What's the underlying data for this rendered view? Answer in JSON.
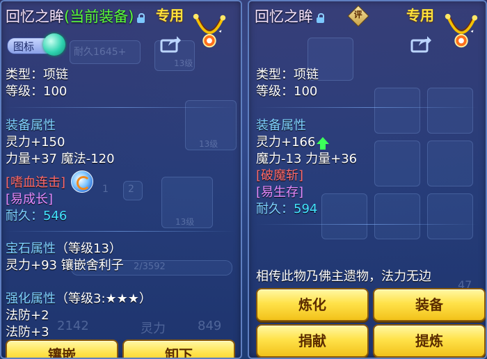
{
  "left": {
    "title": "回忆之眸",
    "equipped_tag": "(当前装备)",
    "exclusive": "专用",
    "icon_toggle_label": "图标",
    "type": "类型：项链",
    "level": "等级：100",
    "equip_attr_header": "装备属性",
    "attr1": "灵力+150",
    "attr2": "力量+37 魔法-120",
    "skill1": "[嗜血连击]",
    "skill2": "[易成长]",
    "durability_label": "耐久：",
    "durability": "546",
    "gem_header": "宝石属性",
    "gem_level": "（等级13）",
    "gem_line": "灵力+93 镶嵌舍利子",
    "enhance_header": "强化属性",
    "enhance_level": "（等级3:★★★）",
    "enhance1": "法防+2",
    "enhance2": "法防+3",
    "btn_inlay": "镶嵌",
    "btn_unequip": "卸下",
    "ghost_texts": [
      "耐久1645+",
      "13级",
      "13级",
      "13级",
      "2",
      "1",
      "2142",
      "灵力",
      "849",
      "2/3592"
    ]
  },
  "right": {
    "title": "回忆之眸",
    "eval_label": "评",
    "exclusive": "专用",
    "type": "类型：项链",
    "level": "等级：100",
    "equip_attr_header": "装备属性",
    "attr1": "灵力+166",
    "attr2": "魔力-13 力量+36",
    "skill1": "[破魔斩]",
    "skill2": "[易生存]",
    "durability_label": "耐久：",
    "durability": "594",
    "description": "相传此物乃佛主遗物，法力无边",
    "btn_refine": "炼化",
    "btn_equip": "装备",
    "btn_donate": "捐献",
    "btn_purify": "提炼",
    "ghost_text": "47"
  },
  "colors": {
    "section_header": "#7fd2ff",
    "red_skill": "#ff6a6a",
    "purple_skill": "#e58bff",
    "durability": "#43e3ff",
    "button_gold": "#ffe24a",
    "exclusive": "#ffe23a"
  }
}
